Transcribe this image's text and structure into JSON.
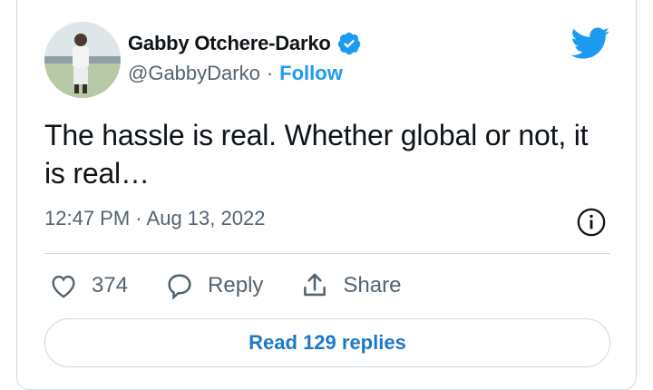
{
  "author": {
    "name": "Gabby Otchere-Darko",
    "handle": "@GabbyDarko",
    "separator": "·",
    "follow_label": "Follow",
    "verified": true
  },
  "tweet": {
    "text": "The hassle is real. Whether global or not, it is real…",
    "time": "12:47 PM",
    "date_separator": "·",
    "date": "Aug 13, 2022"
  },
  "actions": {
    "likes_count": "374",
    "reply_label": "Reply",
    "share_label": "Share"
  },
  "read_replies_label": "Read 129 replies",
  "icons": [
    "heart-icon",
    "reply-icon",
    "share-icon",
    "twitter-bird-icon",
    "verified-badge-icon",
    "info-icon"
  ],
  "colors": {
    "accent": "#1d9bf0",
    "text": "#0f1419",
    "muted": "#536471",
    "border": "#cfd9de"
  }
}
